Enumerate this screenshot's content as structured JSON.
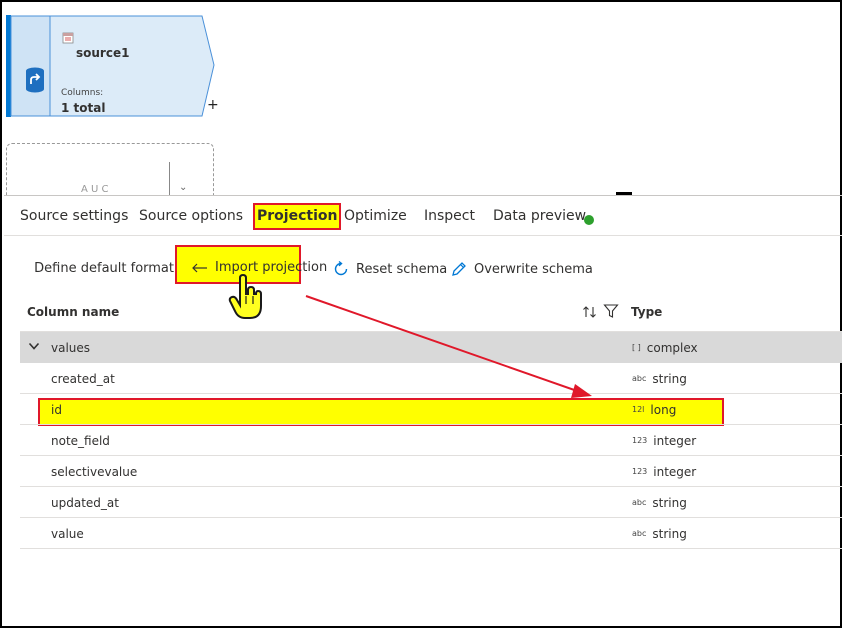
{
  "node": {
    "title": "source1",
    "columns_label": "Columns:",
    "columns_value": "1 total",
    "add_symbol": "+",
    "ghost_text": "A U C"
  },
  "tabs": [
    {
      "label": "Source settings"
    },
    {
      "label": "Source options"
    },
    {
      "label": "Projection",
      "active": true
    },
    {
      "label": "Optimize"
    },
    {
      "label": "Inspect"
    },
    {
      "label": "Data preview",
      "status_color": "#2da02d"
    }
  ],
  "toolbar": {
    "define_format": "Define default format",
    "import_projection": "Import projection",
    "reset_schema": "Reset schema",
    "overwrite_schema": "Overwrite schema"
  },
  "table": {
    "col_name_header": "Column name",
    "type_header": "Type",
    "rows": [
      {
        "name": "values",
        "type_glyph": "[ ]",
        "type": "complex",
        "expandable": true,
        "expanded": true
      },
      {
        "name": "created_at",
        "type_glyph": "abc",
        "type": "string"
      },
      {
        "name": "id",
        "type_glyph": "12l",
        "type": "long",
        "highlighted": true
      },
      {
        "name": "note_field",
        "type_glyph": "123",
        "type": "integer"
      },
      {
        "name": "selectivevalue",
        "type_glyph": "123",
        "type": "integer"
      },
      {
        "name": "updated_at",
        "type_glyph": "abc",
        "type": "string"
      },
      {
        "name": "value",
        "type_glyph": "abc",
        "type": "string"
      }
    ]
  },
  "colors": {
    "highlight": "#ffff00",
    "annotation_red": "#e0182a",
    "accent_blue": "#0078d4"
  }
}
